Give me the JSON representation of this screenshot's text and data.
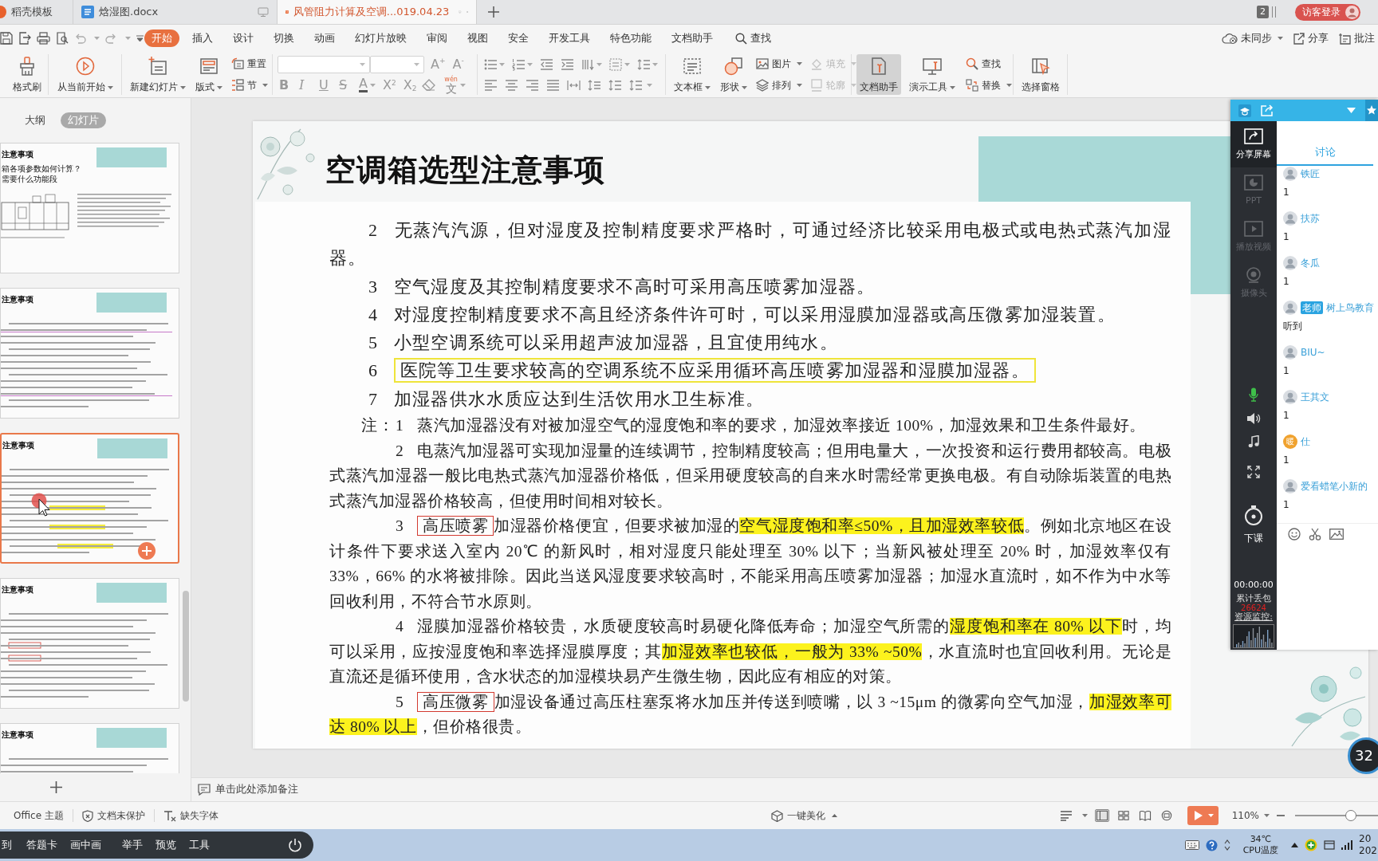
{
  "window_tabs": [
    {
      "label": "稻壳模板",
      "selected": false
    },
    {
      "label": "焓湿图.docx",
      "selected": false
    },
    {
      "label": "风管阻力计算及空调...019.04.23",
      "selected": true
    }
  ],
  "window_count": "2",
  "login_button": "访客登录",
  "menu_tabs": [
    {
      "label": "开始",
      "selected": true
    },
    {
      "label": "插入",
      "selected": false
    },
    {
      "label": "设计",
      "selected": false
    },
    {
      "label": "切换",
      "selected": false
    },
    {
      "label": "动画",
      "selected": false
    },
    {
      "label": "幻灯片放映",
      "selected": false
    },
    {
      "label": "审阅",
      "selected": false
    },
    {
      "label": "视图",
      "selected": false
    },
    {
      "label": "安全",
      "selected": false
    },
    {
      "label": "开发工具",
      "selected": false
    },
    {
      "label": "特色功能",
      "selected": false
    },
    {
      "label": "文档助手",
      "selected": false
    }
  ],
  "menu_search": "查找",
  "account_actions": [
    {
      "label": "未同步",
      "dropdown": true
    },
    {
      "label": "分享",
      "dropdown": false
    },
    {
      "label": "批注",
      "dropdown": false
    }
  ],
  "ribbon": {
    "format_painter": {
      "label": "格式刷",
      "dropdown": false
    },
    "play": {
      "label": "从当前开始",
      "dropdown": true
    },
    "slide_buttons": [
      {
        "label": "新建幻灯片",
        "dropdown": true
      },
      {
        "label": "版式",
        "dropdown": true
      }
    ],
    "slide_small_buttons": [
      {
        "label": "重置",
        "dropdown": false
      },
      {
        "label": "节",
        "dropdown": true
      }
    ],
    "font_size_buttons": [
      "A$^{+}$",
      "A$^{-}$"
    ],
    "format_buttons": [
      {
        "glyph": "B",
        "dropdown": false
      },
      {
        "glyph": "I",
        "dropdown": false
      },
      {
        "glyph": "U",
        "dropdown": false
      },
      {
        "glyph": "S",
        "dropdown": false
      },
      {
        "glyph": "A",
        "dropdown": true
      },
      {
        "glyph": "X$^{2}$",
        "dropdown": false
      },
      {
        "glyph": "X$_{2}$",
        "dropdown": false
      }
    ],
    "phonetic_button": {
      "glyph": "文",
      "ruby": "wén",
      "dropdown": true
    },
    "insert_buttons": [
      {
        "label": "文本框",
        "kind": "large",
        "dropdown": true,
        "disabled": false
      },
      {
        "label": "形状",
        "kind": "large",
        "dropdown": true,
        "disabled": false
      },
      {
        "label": "图片",
        "kind": "small",
        "dropdown": true,
        "disabled": false
      },
      {
        "label": "排列",
        "kind": "small",
        "dropdown": true,
        "disabled": false
      },
      {
        "label": "填充",
        "kind": "small",
        "dropdown": true,
        "disabled": true
      },
      {
        "label": "轮廓",
        "kind": "small",
        "dropdown": true,
        "disabled": true
      }
    ],
    "tool_buttons": [
      {
        "label": "文档助手",
        "kind": "large",
        "dropdown": false,
        "pressed": true
      },
      {
        "label": "演示工具",
        "kind": "large",
        "dropdown": true,
        "pressed": false
      },
      {
        "label": "查找",
        "kind": "small",
        "dropdown": false,
        "pressed": false
      },
      {
        "label": "替换",
        "kind": "small",
        "dropdown": true,
        "pressed": false
      }
    ],
    "pane_button": {
      "label": "选择窗格"
    }
  },
  "outline_tabs": [
    {
      "label": "大纲",
      "selected": false
    },
    {
      "label": "幻灯片",
      "selected": true
    }
  ],
  "thumbnails": [
    {
      "title": "注意事项",
      "subtitle_lines": [
        "箱各项参数如何计算？",
        "需要什么功能段"
      ],
      "selected": false
    },
    {
      "title": "注意事项",
      "selected": false
    },
    {
      "title": "注意事项",
      "selected": true
    },
    {
      "title": "注意事项",
      "selected": false
    },
    {
      "title": "注意事项",
      "selected": false
    }
  ],
  "slide": {
    "title": "空调箱选型注意事项",
    "items": [
      {
        "number": "2",
        "text": "无蒸汽汽源，但对湿度及控制精度要求严格时，可通过经济比较采用电极式或电热式蒸汽加湿器。",
        "outlined": false
      },
      {
        "number": "3",
        "text": "空气湿度及其控制精度要求不高时可采用高压喷雾加湿器。",
        "outlined": false
      },
      {
        "number": "4",
        "text": "对湿度控制精度要求不高且经济条件许可时，可以采用湿膜加湿器或高压微雾加湿装置。",
        "outlined": false
      },
      {
        "number": "5",
        "text": "小型空调系统可以采用超声波加湿器，且宜使用纯水。",
        "outlined": false
      },
      {
        "number": "6",
        "text": "医院等卫生要求较高的空调系统不应采用循环高压喷雾加湿器和湿膜加湿器。",
        "outlined": true
      },
      {
        "number": "7",
        "text": "加湿器供水水质应达到生活饮用水卫生标准。",
        "outlined": false
      }
    ],
    "notes_label": "注：",
    "notes": [
      {
        "number": "1",
        "segments": [
          {
            "kind": "plain",
            "text": "蒸汽加湿器没有对被加湿空气的湿度饱和率的要求，加湿效率接近 100%，加湿效果和卫生条件最好。"
          }
        ]
      },
      {
        "number": "2",
        "segments": [
          {
            "kind": "plain",
            "text": "电蒸汽加湿器可实现加湿量的连续调节，控制精度较高；但用电量大，一次投资和运行费用都较高。电极式蒸汽加湿器一般比电热式蒸汽加湿器价格低，但采用硬度较高的自来水时需经常更换电极。有自动除垢装置的电热式蒸汽加湿器价格较高，但使用时间相对较长。"
          }
        ]
      },
      {
        "number": "3",
        "segments": [
          {
            "kind": "boxed",
            "text": "高压喷雾"
          },
          {
            "kind": "plain",
            "text": "加湿器价格便宜，但要求被加湿的"
          },
          {
            "kind": "highlight",
            "text": "空气湿度饱和率≤50%，且加湿效率较低"
          },
          {
            "kind": "plain",
            "text": "。例如北京地区在设计条件下要求送入室内 20℃ 的新风时，相对湿度只能处理至 30% 以下；当新风被处理至 20% 时，加湿效率仅有 33%，66% 的水将被排除。因此当送风湿度要求较高时，不能采用高压喷雾加湿器；加湿水直流时，如不作为中水等回收利用，不符合节水原则。"
          }
        ]
      },
      {
        "number": "4",
        "segments": [
          {
            "kind": "plain",
            "text": "湿膜加湿器价格较贵，水质硬度较高时易硬化降低寿命；加湿空气所需的"
          },
          {
            "kind": "highlight",
            "text": "湿度饱和率在 80% 以下"
          },
          {
            "kind": "plain",
            "text": "时，均可以采用，应按湿度饱和率选择湿膜厚度；其"
          },
          {
            "kind": "highlight",
            "text": "加湿效率也较低，一般为 33% ~50%"
          },
          {
            "kind": "plain",
            "text": "，水直流时也宜回收利用。无论是直流还是循环使用，含水状态的加湿模块易产生微生物，因此应有相应的对策。"
          }
        ]
      },
      {
        "number": "5",
        "segments": [
          {
            "kind": "boxed",
            "text": "高压微雾"
          },
          {
            "kind": "plain",
            "text": "加湿设备通过高压柱塞泵将水加压并传送到喷嘴，以 3 ~15μm 的微雾向空气加湿，"
          },
          {
            "kind": "highlight",
            "text": "加湿效率可达 80% 以上"
          },
          {
            "kind": "plain",
            "text": "，但价格很贵。"
          }
        ]
      }
    ]
  },
  "notes_placeholder": "单击此处添加备注",
  "status_bar": {
    "theme": "Office 主题",
    "protection": "文档未保护",
    "missing_fonts": "缺失字体",
    "beautify": "一键美化",
    "views": [
      {
        "selected": true
      },
      {
        "selected": false
      },
      {
        "selected": false
      },
      {
        "selected": false
      }
    ],
    "zoom": "110%",
    "zoom_slider": {
      "level": 0.67
    }
  },
  "live_panel": {
    "tools": [
      {
        "label": "分享屏幕",
        "disabled": false
      },
      {
        "label": "PPT",
        "disabled": true
      },
      {
        "label": "播放视频",
        "disabled": true
      },
      {
        "label": "摄像头",
        "disabled": true
      }
    ],
    "mic_on": true,
    "end_class": "下课",
    "timer": "00:00:00",
    "packet_loss_label": "累计丢包",
    "packet_loss": "26624",
    "monitor_label": "资源监控:",
    "chat_tab": "讨论",
    "messages": [
      {
        "name": "铁匠",
        "text": "1"
      },
      {
        "name": "扶苏",
        "text": "1"
      },
      {
        "name": "冬瓜",
        "text": "1"
      },
      {
        "name": "树上鸟教育",
        "role": "老师",
        "text": "听到"
      },
      {
        "name": "BIU~",
        "text": "1"
      },
      {
        "name": "王其文",
        "text": "1"
      },
      {
        "name": "仕",
        "avatar_text": "暖",
        "text": "1"
      },
      {
        "name": "爱看蜡笔小新的",
        "text": "1"
      }
    ]
  },
  "timer_bubble": "32",
  "class_toolbar": [
    "到",
    "答题卡",
    "画中画",
    "举手",
    "预览",
    "工具"
  ],
  "tray": {
    "temperature": "34℃",
    "sensor_label": "CPU温度",
    "clock": [
      "20",
      "202"
    ]
  }
}
